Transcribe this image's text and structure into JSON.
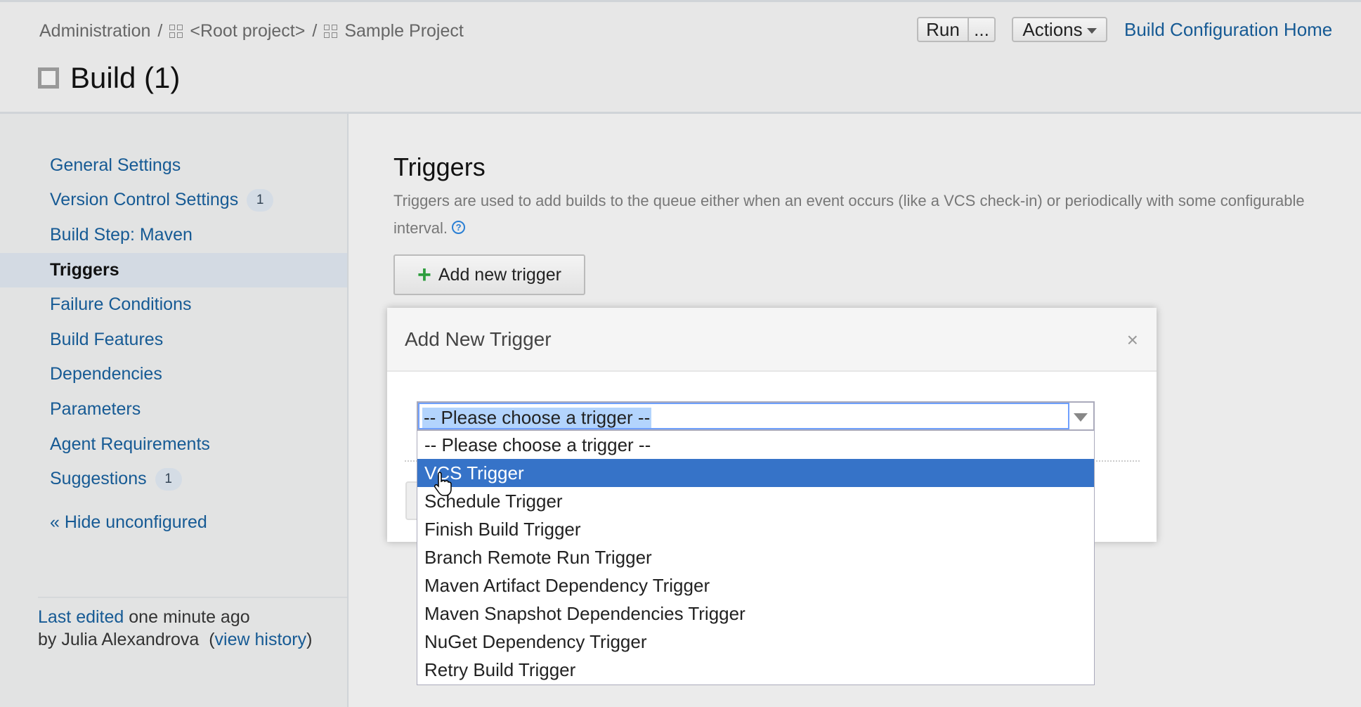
{
  "breadcrumb": [
    "Administration",
    "<Root project>",
    "Sample Project"
  ],
  "title": "Build (1)",
  "toolbar": {
    "run": "Run",
    "more": "...",
    "actions": "Actions",
    "home_link": "Build Configuration Home"
  },
  "sidebar": {
    "items": [
      {
        "label": "General Settings"
      },
      {
        "label": "Version Control Settings",
        "badge": "1"
      },
      {
        "label": "Build Step: Maven"
      },
      {
        "label": "Triggers",
        "selected": true
      },
      {
        "label": "Failure Conditions"
      },
      {
        "label": "Build Features"
      },
      {
        "label": "Dependencies"
      },
      {
        "label": "Parameters"
      },
      {
        "label": "Agent Requirements"
      },
      {
        "label": "Suggestions",
        "badge": "1"
      }
    ],
    "hide_unconfigured": "« Hide unconfigured",
    "last_edited": {
      "link": "Last edited",
      "when": "one minute ago",
      "by": "by Julia Alexandrova",
      "view_history": "view history"
    }
  },
  "main": {
    "heading": "Triggers",
    "description": "Triggers are used to add builds to the queue either when an event occurs (like a VCS check-in) or periodically with some configurable interval.",
    "add_button": "Add new trigger"
  },
  "dialog": {
    "title": "Add New Trigger",
    "close": "×",
    "select_value": "-- Please choose a trigger --",
    "options": [
      "-- Please choose a trigger --",
      "VCS Trigger",
      "Schedule Trigger",
      "Finish Build Trigger",
      "Branch Remote Run Trigger",
      "Maven Artifact Dependency Trigger",
      "Maven Snapshot Dependencies Trigger",
      "NuGet Dependency Trigger",
      "Retry Build Trigger"
    ],
    "highlighted": "VCS Trigger"
  },
  "colors": {
    "link": "#165a94",
    "highlight": "#3673c8",
    "selected_nav": "#d3dae3"
  }
}
